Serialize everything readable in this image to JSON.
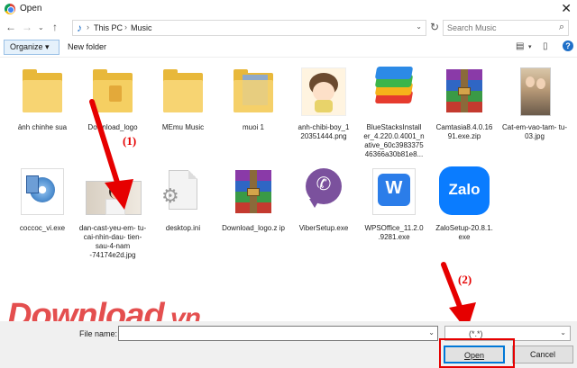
{
  "window": {
    "title": "Open"
  },
  "address": {
    "crumbs": [
      "This PC",
      "Music"
    ]
  },
  "search": {
    "placeholder": "Search Music"
  },
  "toolbar": {
    "organize_label": "Organize ▾",
    "new_folder_label": "New folder"
  },
  "files": [
    {
      "name": "ảnh chinhe sua",
      "kind": "folder"
    },
    {
      "name": "Download_logo",
      "kind": "folder"
    },
    {
      "name": "MEmu Music",
      "kind": "folder"
    },
    {
      "name": "muoi 1",
      "kind": "folder"
    },
    {
      "name": "anh-chibi-boy_1 20351444.png",
      "kind": "image"
    },
    {
      "name": "BlueStacksInstall er_4.220.0.4001_n ative_60c3983375 46366a30b81e8...",
      "kind": "exe"
    },
    {
      "name": "Camtasia8.4.0.16 91.exe.zip",
      "kind": "rar"
    },
    {
      "name": "Cat-em-vao-tam- tu-03.jpg",
      "kind": "image"
    },
    {
      "name": "coccoc_vi.exe",
      "kind": "exe"
    },
    {
      "name": "dan-cast-yeu-em- tu-cai-nhin-dau- tien-sau-4-nam -74174e2d.jpg",
      "kind": "image"
    },
    {
      "name": "desktop.ini",
      "kind": "doc"
    },
    {
      "name": "Download_logo.z ip",
      "kind": "rar"
    },
    {
      "name": "ViberSetup.exe",
      "kind": "exe"
    },
    {
      "name": "WPSOffice_11.2.0 .9281.exe",
      "kind": "exe"
    },
    {
      "name": "ZaloSetup-20.8.1. exe",
      "kind": "exe"
    }
  ],
  "annotations": {
    "step1": "(1)",
    "step2": "(2)"
  },
  "bottom": {
    "file_name_label": "File name:",
    "file_name_value": "",
    "file_type": "(*.*)",
    "open_label": "Open",
    "cancel_label": "Cancel"
  },
  "watermark": {
    "main": "Download",
    "suffix": ".vn"
  },
  "colors": {
    "accent": "#0078d7",
    "annotation_red": "#e60000",
    "folder": "#f7d472"
  }
}
